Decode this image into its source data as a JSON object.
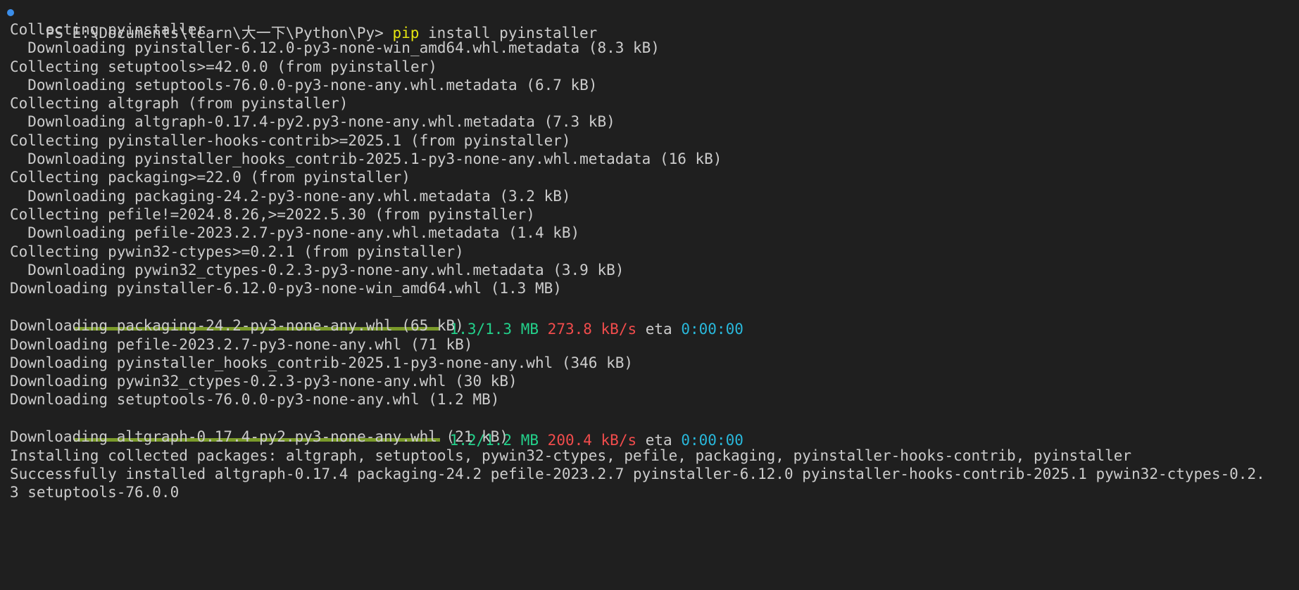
{
  "terminal": {
    "prompt": "PS E:\\Documents\\learn\\大一下\\Python\\Py> ",
    "command_name": "pip",
    "command_args": " install pyinstaller",
    "lines": [
      "Collecting pyinstaller",
      "  Downloading pyinstaller-6.12.0-py3-none-win_amd64.whl.metadata (8.3 kB)",
      "Collecting setuptools>=42.0.0 (from pyinstaller)",
      "  Downloading setuptools-76.0.0-py3-none-any.whl.metadata (6.7 kB)",
      "Collecting altgraph (from pyinstaller)",
      "  Downloading altgraph-0.17.4-py2.py3-none-any.whl.metadata (7.3 kB)",
      "Collecting pyinstaller-hooks-contrib>=2025.1 (from pyinstaller)",
      "  Downloading pyinstaller_hooks_contrib-2025.1-py3-none-any.whl.metadata (16 kB)",
      "Collecting packaging>=22.0 (from pyinstaller)",
      "  Downloading packaging-24.2-py3-none-any.whl.metadata (3.2 kB)",
      "Collecting pefile!=2024.8.26,>=2022.5.30 (from pyinstaller)",
      "  Downloading pefile-2023.2.7-py3-none-any.whl.metadata (1.4 kB)",
      "Collecting pywin32-ctypes>=0.2.1 (from pyinstaller)",
      "  Downloading pywin32_ctypes-0.2.3-py3-none-any.whl.metadata (3.9 kB)",
      "Downloading pyinstaller-6.12.0-py3-none-win_amd64.whl (1.3 MB)"
    ],
    "progress1": {
      "fraction": 1.0,
      "size": "1.3/1.3 MB",
      "speed": "273.8 kB/s",
      "eta_label": "eta",
      "eta": "0:00:00"
    },
    "lines2": [
      "Downloading packaging-24.2-py3-none-any.whl (65 kB)",
      "Downloading pefile-2023.2.7-py3-none-any.whl (71 kB)",
      "Downloading pyinstaller_hooks_contrib-2025.1-py3-none-any.whl (346 kB)",
      "Downloading pywin32_ctypes-0.2.3-py3-none-any.whl (30 kB)",
      "Downloading setuptools-76.0.0-py3-none-any.whl (1.2 MB)"
    ],
    "progress2": {
      "fraction": 1.0,
      "size": "1.2/1.2 MB",
      "speed": "200.4 kB/s",
      "eta_label": "eta",
      "eta": "0:00:00"
    },
    "lines3": [
      "Downloading altgraph-0.17.4-py2.py3-none-any.whl (21 kB)",
      "Installing collected packages: altgraph, setuptools, pywin32-ctypes, pefile, packaging, pyinstaller-hooks-contrib, pyinstaller",
      "Successfully installed altgraph-0.17.4 packaging-24.2 pefile-2023.2.7 pyinstaller-6.12.0 pyinstaller-hooks-contrib-2025.1 pywin32-ctypes-0.2.",
      "3 setuptools-76.0.0"
    ]
  },
  "colors": {
    "background": "#1f1f1f",
    "text": "#cccccc",
    "command": "#e5e510",
    "progress_bar": "#7a9a2a",
    "size": "#23d18b",
    "speed": "#f14c4c",
    "eta": "#29b8db"
  }
}
